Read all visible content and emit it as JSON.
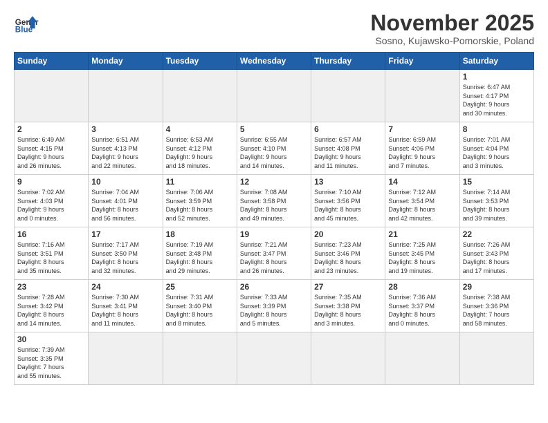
{
  "header": {
    "logo_general": "General",
    "logo_blue": "Blue",
    "month_title": "November 2025",
    "subtitle": "Sosno, Kujawsko-Pomorskie, Poland"
  },
  "weekdays": [
    "Sunday",
    "Monday",
    "Tuesday",
    "Wednesday",
    "Thursday",
    "Friday",
    "Saturday"
  ],
  "weeks": [
    [
      {
        "day": "",
        "info": "",
        "empty": true
      },
      {
        "day": "",
        "info": "",
        "empty": true
      },
      {
        "day": "",
        "info": "",
        "empty": true
      },
      {
        "day": "",
        "info": "",
        "empty": true
      },
      {
        "day": "",
        "info": "",
        "empty": true
      },
      {
        "day": "",
        "info": "",
        "empty": true
      },
      {
        "day": "1",
        "info": "Sunrise: 6:47 AM\nSunset: 4:17 PM\nDaylight: 9 hours\nand 30 minutes.",
        "empty": false
      }
    ],
    [
      {
        "day": "2",
        "info": "Sunrise: 6:49 AM\nSunset: 4:15 PM\nDaylight: 9 hours\nand 26 minutes.",
        "empty": false
      },
      {
        "day": "3",
        "info": "Sunrise: 6:51 AM\nSunset: 4:13 PM\nDaylight: 9 hours\nand 22 minutes.",
        "empty": false
      },
      {
        "day": "4",
        "info": "Sunrise: 6:53 AM\nSunset: 4:12 PM\nDaylight: 9 hours\nand 18 minutes.",
        "empty": false
      },
      {
        "day": "5",
        "info": "Sunrise: 6:55 AM\nSunset: 4:10 PM\nDaylight: 9 hours\nand 14 minutes.",
        "empty": false
      },
      {
        "day": "6",
        "info": "Sunrise: 6:57 AM\nSunset: 4:08 PM\nDaylight: 9 hours\nand 11 minutes.",
        "empty": false
      },
      {
        "day": "7",
        "info": "Sunrise: 6:59 AM\nSunset: 4:06 PM\nDaylight: 9 hours\nand 7 minutes.",
        "empty": false
      },
      {
        "day": "8",
        "info": "Sunrise: 7:01 AM\nSunset: 4:04 PM\nDaylight: 9 hours\nand 3 minutes.",
        "empty": false
      }
    ],
    [
      {
        "day": "9",
        "info": "Sunrise: 7:02 AM\nSunset: 4:03 PM\nDaylight: 9 hours\nand 0 minutes.",
        "empty": false
      },
      {
        "day": "10",
        "info": "Sunrise: 7:04 AM\nSunset: 4:01 PM\nDaylight: 8 hours\nand 56 minutes.",
        "empty": false
      },
      {
        "day": "11",
        "info": "Sunrise: 7:06 AM\nSunset: 3:59 PM\nDaylight: 8 hours\nand 52 minutes.",
        "empty": false
      },
      {
        "day": "12",
        "info": "Sunrise: 7:08 AM\nSunset: 3:58 PM\nDaylight: 8 hours\nand 49 minutes.",
        "empty": false
      },
      {
        "day": "13",
        "info": "Sunrise: 7:10 AM\nSunset: 3:56 PM\nDaylight: 8 hours\nand 45 minutes.",
        "empty": false
      },
      {
        "day": "14",
        "info": "Sunrise: 7:12 AM\nSunset: 3:54 PM\nDaylight: 8 hours\nand 42 minutes.",
        "empty": false
      },
      {
        "day": "15",
        "info": "Sunrise: 7:14 AM\nSunset: 3:53 PM\nDaylight: 8 hours\nand 39 minutes.",
        "empty": false
      }
    ],
    [
      {
        "day": "16",
        "info": "Sunrise: 7:16 AM\nSunset: 3:51 PM\nDaylight: 8 hours\nand 35 minutes.",
        "empty": false
      },
      {
        "day": "17",
        "info": "Sunrise: 7:17 AM\nSunset: 3:50 PM\nDaylight: 8 hours\nand 32 minutes.",
        "empty": false
      },
      {
        "day": "18",
        "info": "Sunrise: 7:19 AM\nSunset: 3:48 PM\nDaylight: 8 hours\nand 29 minutes.",
        "empty": false
      },
      {
        "day": "19",
        "info": "Sunrise: 7:21 AM\nSunset: 3:47 PM\nDaylight: 8 hours\nand 26 minutes.",
        "empty": false
      },
      {
        "day": "20",
        "info": "Sunrise: 7:23 AM\nSunset: 3:46 PM\nDaylight: 8 hours\nand 23 minutes.",
        "empty": false
      },
      {
        "day": "21",
        "info": "Sunrise: 7:25 AM\nSunset: 3:45 PM\nDaylight: 8 hours\nand 19 minutes.",
        "empty": false
      },
      {
        "day": "22",
        "info": "Sunrise: 7:26 AM\nSunset: 3:43 PM\nDaylight: 8 hours\nand 17 minutes.",
        "empty": false
      }
    ],
    [
      {
        "day": "23",
        "info": "Sunrise: 7:28 AM\nSunset: 3:42 PM\nDaylight: 8 hours\nand 14 minutes.",
        "empty": false
      },
      {
        "day": "24",
        "info": "Sunrise: 7:30 AM\nSunset: 3:41 PM\nDaylight: 8 hours\nand 11 minutes.",
        "empty": false
      },
      {
        "day": "25",
        "info": "Sunrise: 7:31 AM\nSunset: 3:40 PM\nDaylight: 8 hours\nand 8 minutes.",
        "empty": false
      },
      {
        "day": "26",
        "info": "Sunrise: 7:33 AM\nSunset: 3:39 PM\nDaylight: 8 hours\nand 5 minutes.",
        "empty": false
      },
      {
        "day": "27",
        "info": "Sunrise: 7:35 AM\nSunset: 3:38 PM\nDaylight: 8 hours\nand 3 minutes.",
        "empty": false
      },
      {
        "day": "28",
        "info": "Sunrise: 7:36 AM\nSunset: 3:37 PM\nDaylight: 8 hours\nand 0 minutes.",
        "empty": false
      },
      {
        "day": "29",
        "info": "Sunrise: 7:38 AM\nSunset: 3:36 PM\nDaylight: 7 hours\nand 58 minutes.",
        "empty": false
      }
    ],
    [
      {
        "day": "30",
        "info": "Sunrise: 7:39 AM\nSunset: 3:35 PM\nDaylight: 7 hours\nand 55 minutes.",
        "empty": false
      },
      {
        "day": "",
        "info": "",
        "empty": true
      },
      {
        "day": "",
        "info": "",
        "empty": true
      },
      {
        "day": "",
        "info": "",
        "empty": true
      },
      {
        "day": "",
        "info": "",
        "empty": true
      },
      {
        "day": "",
        "info": "",
        "empty": true
      },
      {
        "day": "",
        "info": "",
        "empty": true
      }
    ]
  ]
}
